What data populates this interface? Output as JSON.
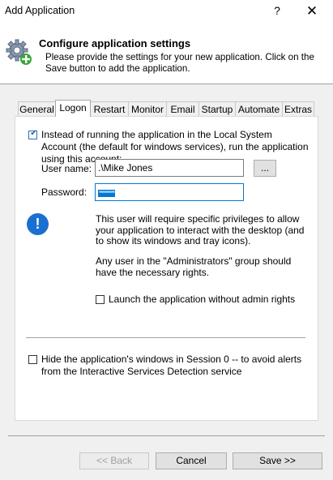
{
  "window": {
    "title": "Add Application",
    "help_glyph": "?",
    "close_glyph": "✕"
  },
  "header": {
    "title": "Configure application settings",
    "description": "Please provide the settings for your new application. Click on the Save button to add the application."
  },
  "tabs": [
    "General",
    "Logon",
    "Restart",
    "Monitor",
    "Email",
    "Startup",
    "Automate",
    "Extras"
  ],
  "active_tab": "Logon",
  "logon": {
    "run_as_label": "Instead of running the application in the Local System Account (the default for windows services), run the application using this account:",
    "run_as_checked": true,
    "username_label": "User name:",
    "username_value": ".\\Mike Jones",
    "browse_label": "...",
    "password_label": "Password:",
    "password_value": "*********",
    "info_text_1": "This user will require specific privileges to allow your application to interact with the desktop (and to show its windows and tray icons).",
    "info_text_2": "Any user in the \"Administrators\" group should have the necessary rights.",
    "launch_no_admin_label": "Launch the application without admin rights",
    "launch_no_admin_checked": false,
    "hide_windows_label": "Hide the application's windows in Session 0 -- to avoid alerts from the Interactive Services Detection service",
    "hide_windows_checked": false
  },
  "footer": {
    "back_label": "<< Back",
    "cancel_label": "Cancel",
    "save_label": "Save >>"
  }
}
